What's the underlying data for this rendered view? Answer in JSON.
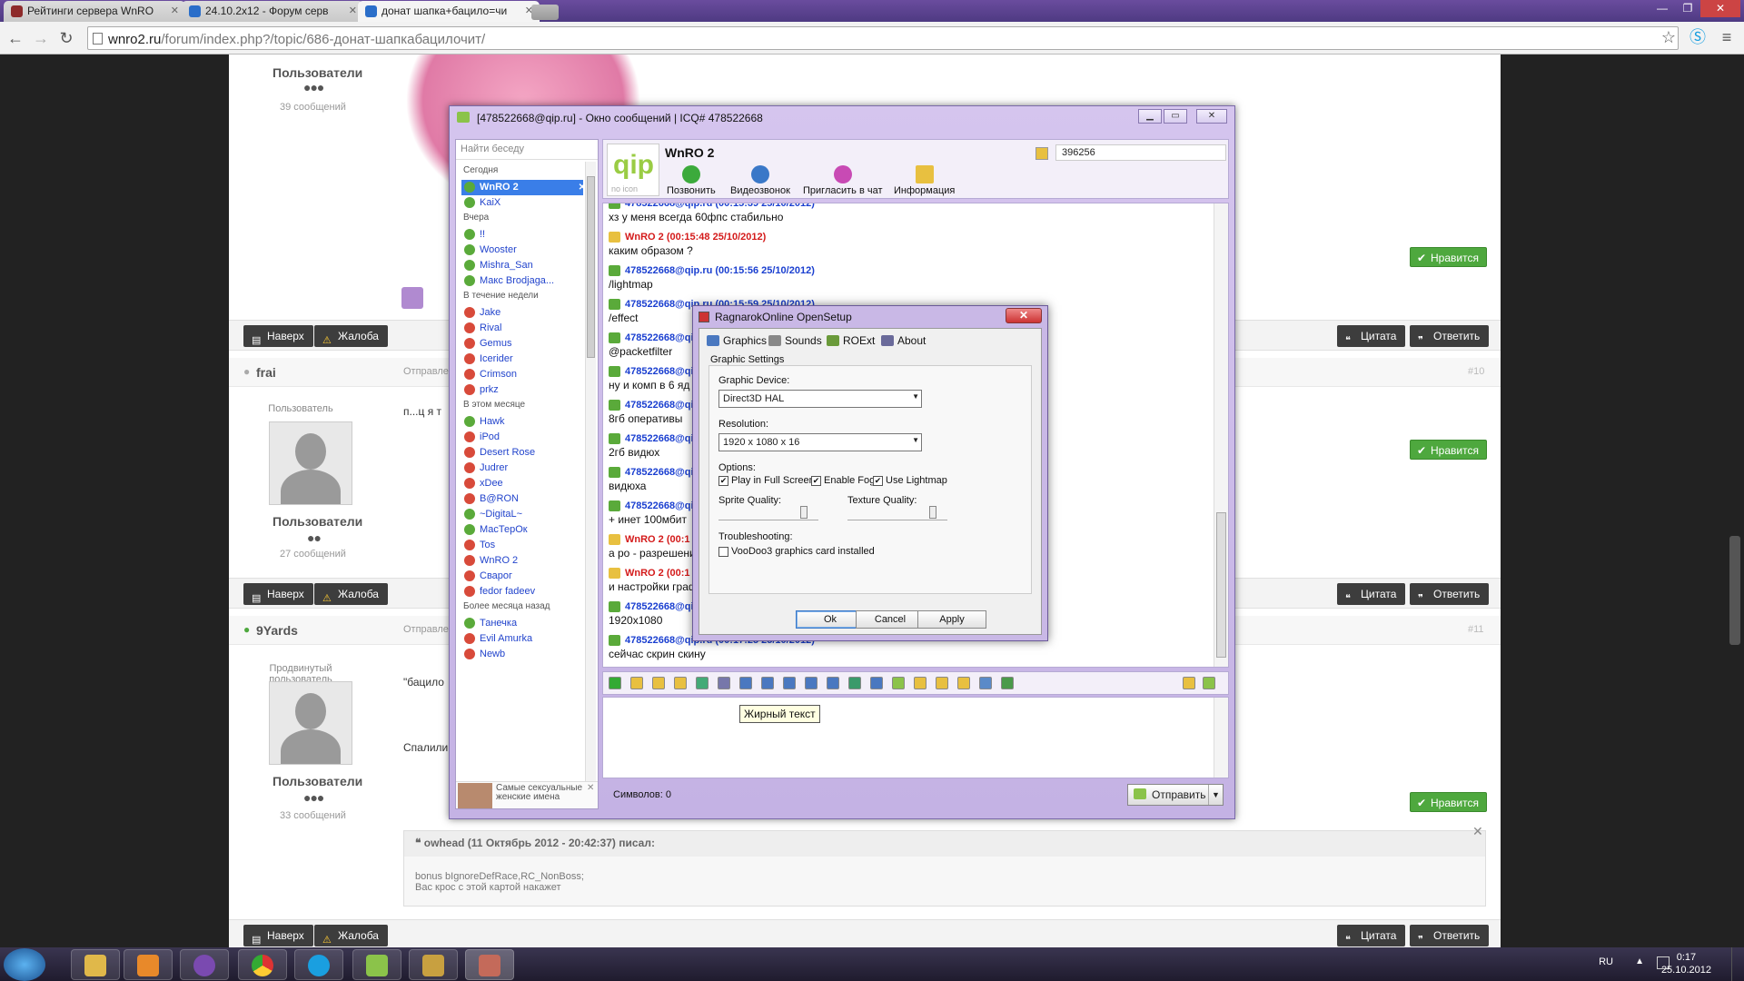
{
  "browser": {
    "tabs": [
      {
        "label": "Рейтинги сервера WnRO",
        "color": "#8e2b2b"
      },
      {
        "label": "24.10.2x12 - Форум серв",
        "color": "#2a6ec9"
      },
      {
        "label": "донат шапка+бацило=чи",
        "color": "#2a6ec9"
      }
    ],
    "url_host": "wnro2.ru",
    "url_path": "/forum/index.php?/topic/686-донат-шапкабацилочит/",
    "winbtns": [
      "—",
      "❐",
      "✕"
    ]
  },
  "forum": {
    "post1": {
      "group_label": "Пользователи",
      "dots": "●●●",
      "count": "39 сообщений"
    },
    "nav_up": "Наверх",
    "complaint": "Жалоба",
    "quote": "Цитата",
    "reply": "Ответить",
    "like": "Нравится",
    "post10": {
      "author": "frai",
      "sent": "Отправле",
      "num": "#10",
      "role": "Пользователь",
      "group_label": "Пользователи",
      "dots": "●●",
      "count": "27 сообщений",
      "text": "п...ц я т"
    },
    "post11": {
      "author": "9Yards",
      "sent": "Отправле",
      "num": "#11",
      "role": "Продвинутый пользователь",
      "group_label": "Пользователи",
      "dots": "●●●",
      "count": "33 сообщений",
      "text1": "\"бацило",
      "text2": "Спалили"
    },
    "quote_block": {
      "header": "owhead (11 Октябрь 2012 - 20:42:37) писал:",
      "line1": "bonus bIgnoreDefRace,RC_NonBoss;",
      "line2": "Вас крос с этой картой накажет"
    }
  },
  "qip": {
    "title": "[478522668@qip.ru] - Окно сообщений | ICQ# 478522668",
    "search_placeholder": "Найти беседу",
    "groups": [
      "Сегодня",
      "Вчера",
      "В течение недели",
      "В этом месяце",
      "Более месяца назад"
    ],
    "today": [
      "WnRO 2",
      "KaiX"
    ],
    "yesterday": [
      "!!",
      "Wooster",
      "Mishra_San",
      "Макс Brodjaga..."
    ],
    "week": [
      "Jake",
      "Rival",
      "Gemus",
      "Icerider",
      "Crimson",
      "prkz"
    ],
    "month": [
      "Hawk",
      "iPod",
      "Desert Rose",
      "Judrer",
      "xDee",
      "B@RON",
      "~DigitaL~",
      "МасТерОк",
      "Tos",
      "WnRO 2",
      "Сварог",
      "fedor fadeev"
    ],
    "older": [
      "Танечка",
      "Evil Amurka",
      "Newb"
    ],
    "ad_text": "Самые сексуальные женские имена",
    "contact_name": "WnRO 2",
    "uin": "396256",
    "logo_q": "qip",
    "logo_sub": "no icon",
    "actions": [
      "Позвонить",
      "Видеозвонок",
      "Пригласить в чат",
      "Информация"
    ],
    "messages": [
      {
        "head": "478522668@qip.ru (00:15:39 25/10/2012)",
        "text": "хз у меня всегда 60фпс стабильно",
        "me": true
      },
      {
        "head": "WnRO 2 (00:15:48 25/10/2012)",
        "text": "каким образом ?",
        "me": false
      },
      {
        "head": "478522668@qip.ru (00:15:56 25/10/2012)",
        "text": "/lightmap",
        "me": true
      },
      {
        "head": "478522668@qip.ru (00:15:59 25/10/2012)",
        "text": "/effect",
        "me": true
      },
      {
        "head": "478522668@qip.ru",
        "text": "@packetfilter",
        "me": true
      },
      {
        "head": "478522668@qip.ru",
        "text": "ну и комп в 6 яд",
        "me": true
      },
      {
        "head": "478522668@qip.ru",
        "text": "8гб оперативы",
        "me": true
      },
      {
        "head": "478522668@qip.ru",
        "text": "2гб видюх",
        "me": true
      },
      {
        "head": "478522668@qip.ru",
        "text": "видюха",
        "me": true
      },
      {
        "head": "478522668@qip.ru",
        "text": "+ инет 100мбит",
        "me": true
      },
      {
        "head": "WnRO 2 (00:1",
        "text": "а ро - разрешени",
        "me": false
      },
      {
        "head": "WnRO 2 (00:1",
        "text": "и настройки граф",
        "me": false
      },
      {
        "head": "478522668@qip.ru",
        "text": "1920x1080",
        "me": true
      },
      {
        "head": "478522668@qip.ru (00:17:25 25/10/2012)",
        "text": "сейчас скрин скину",
        "me": true
      }
    ],
    "tooltip": "Жирный текст",
    "char_label": "Символов:",
    "char_count": "0",
    "send": "Отправить"
  },
  "opensetup": {
    "title": "RagnarokOnline OpenSetup",
    "tabs": [
      "Graphics",
      "Sounds",
      "ROExt",
      "About"
    ],
    "group": "Graphic Settings",
    "device_label": "Graphic Device:",
    "device_value": "Direct3D HAL",
    "res_label": "Resolution:",
    "res_value": "1920 x 1080 x 16",
    "options_label": "Options:",
    "opt_full": "Play in Full Screen",
    "opt_fog": "Enable Fog",
    "opt_lightmap": "Use Lightmap",
    "sprite_label": "Sprite Quality:",
    "texture_label": "Texture Quality:",
    "sprite_level": 0.9,
    "texture_level": 0.9,
    "trouble_label": "Troubleshooting:",
    "voodoo": "VooDoo3 graphics card installed",
    "ok": "Ok",
    "cancel": "Cancel",
    "apply": "Apply"
  },
  "taskbar": {
    "lang": "RU",
    "time": "0:17",
    "date": "25.10.2012"
  }
}
